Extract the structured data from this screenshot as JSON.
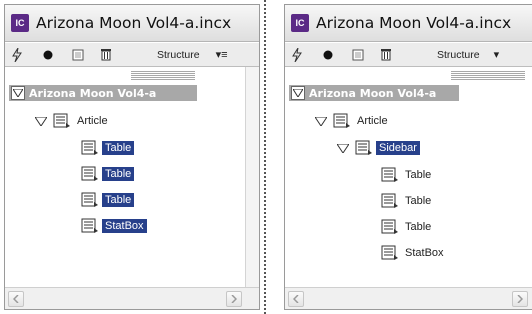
{
  "colors": {
    "selection": "#27408b",
    "root_bar": "#a8a8a8",
    "app_icon": "#5b2a86"
  },
  "panels": [
    {
      "title": "Arizona Moon Vol4-a.incx",
      "app_icon_text": "IC",
      "toolbar": {
        "structure_label": "Structure",
        "menu_glyph": "▾≡"
      },
      "root_label": "Arizona Moon Vol4-a",
      "nodes": [
        {
          "label": "Article",
          "icon": "article-element-icon",
          "selected": false
        },
        {
          "label": "Table",
          "icon": "text-element-icon",
          "selected": true
        },
        {
          "label": "Table",
          "icon": "text-element-icon",
          "selected": true
        },
        {
          "label": "Table",
          "icon": "text-element-icon",
          "selected": true
        },
        {
          "label": "StatBox",
          "icon": "text-element-icon",
          "selected": true
        }
      ]
    },
    {
      "title": "Arizona Moon Vol4-a.incx",
      "app_icon_text": "IC",
      "toolbar": {
        "structure_label": "Structure",
        "menu_glyph": "▾"
      },
      "root_label": "Arizona Moon Vol4-a",
      "nodes": [
        {
          "label": "Article",
          "icon": "article-element-icon",
          "selected": false
        },
        {
          "label": "Sidebar",
          "icon": "text-element-icon",
          "selected": true
        },
        {
          "label": "Table",
          "icon": "text-element-icon",
          "selected": false
        },
        {
          "label": "Table",
          "icon": "text-element-icon",
          "selected": false
        },
        {
          "label": "Table",
          "icon": "text-element-icon",
          "selected": false
        },
        {
          "label": "StatBox",
          "icon": "text-element-icon",
          "selected": false
        }
      ]
    }
  ]
}
